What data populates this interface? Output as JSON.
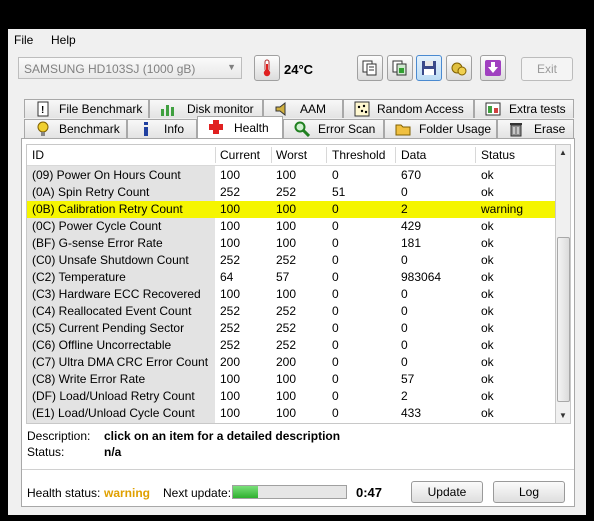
{
  "menu": {
    "file": "File",
    "help": "Help"
  },
  "toolbar": {
    "drive": "SAMSUNG HD103SJ (1000 gB)",
    "temperature": "24°C",
    "exit": "Exit"
  },
  "tabs_row1": [
    {
      "label": "File Benchmark",
      "icon": "file-benchmark-icon"
    },
    {
      "label": "Disk monitor",
      "icon": "disk-monitor-icon"
    },
    {
      "label": "AAM",
      "icon": "speaker-icon"
    },
    {
      "label": "Random Access",
      "icon": "random-access-icon"
    },
    {
      "label": "Extra tests",
      "icon": "extra-tests-icon"
    }
  ],
  "tabs_row2": [
    {
      "label": "Benchmark",
      "icon": "lightbulb-icon"
    },
    {
      "label": "Info",
      "icon": "info-icon"
    },
    {
      "label": "Health",
      "icon": "health-cross-icon"
    },
    {
      "label": "Error Scan",
      "icon": "magnifier-icon"
    },
    {
      "label": "Folder Usage",
      "icon": "folder-icon"
    },
    {
      "label": "Erase",
      "icon": "trash-icon"
    }
  ],
  "table": {
    "headers": [
      "ID",
      "Current",
      "Worst",
      "Threshold",
      "Data",
      "Status"
    ],
    "rows": [
      [
        "(09) Power On Hours Count",
        "100",
        "100",
        "0",
        "670",
        "ok"
      ],
      [
        "(0A) Spin Retry Count",
        "252",
        "252",
        "51",
        "0",
        "ok"
      ],
      [
        "(0B) Calibration Retry Count",
        "100",
        "100",
        "0",
        "2",
        "warning"
      ],
      [
        "(0C) Power Cycle Count",
        "100",
        "100",
        "0",
        "429",
        "ok"
      ],
      [
        "(BF) G-sense Error Rate",
        "100",
        "100",
        "0",
        "181",
        "ok"
      ],
      [
        "(C0) Unsafe Shutdown Count",
        "252",
        "252",
        "0",
        "0",
        "ok"
      ],
      [
        "(C2) Temperature",
        "64",
        "57",
        "0",
        "983064",
        "ok"
      ],
      [
        "(C3) Hardware ECC Recovered",
        "100",
        "100",
        "0",
        "0",
        "ok"
      ],
      [
        "(C4) Reallocated Event Count",
        "252",
        "252",
        "0",
        "0",
        "ok"
      ],
      [
        "(C5) Current Pending Sector",
        "252",
        "252",
        "0",
        "0",
        "ok"
      ],
      [
        "(C6) Offline Uncorrectable",
        "252",
        "252",
        "0",
        "0",
        "ok"
      ],
      [
        "(C7) Ultra DMA CRC Error Count",
        "200",
        "200",
        "0",
        "0",
        "ok"
      ],
      [
        "(C8) Write Error Rate",
        "100",
        "100",
        "0",
        "57",
        "ok"
      ],
      [
        "(DF) Load/Unload Retry Count",
        "100",
        "100",
        "0",
        "2",
        "ok"
      ],
      [
        "(E1) Load/Unload Cycle Count",
        "100",
        "100",
        "0",
        "433",
        "ok"
      ]
    ],
    "highlighted_row": 2,
    "highlight_color": "#f5f500"
  },
  "description": {
    "label": "Description:",
    "value": "click on an item for a detailed description",
    "status_label": "Status:",
    "status_value": "n/a"
  },
  "footer": {
    "health_label": "Health status:",
    "health_value": "warning",
    "health_color": "#e0a000",
    "next_update_label": "Next update:",
    "progress_fraction": 0.22,
    "timer": "0:47",
    "update_button": "Update",
    "log_button": "Log"
  }
}
